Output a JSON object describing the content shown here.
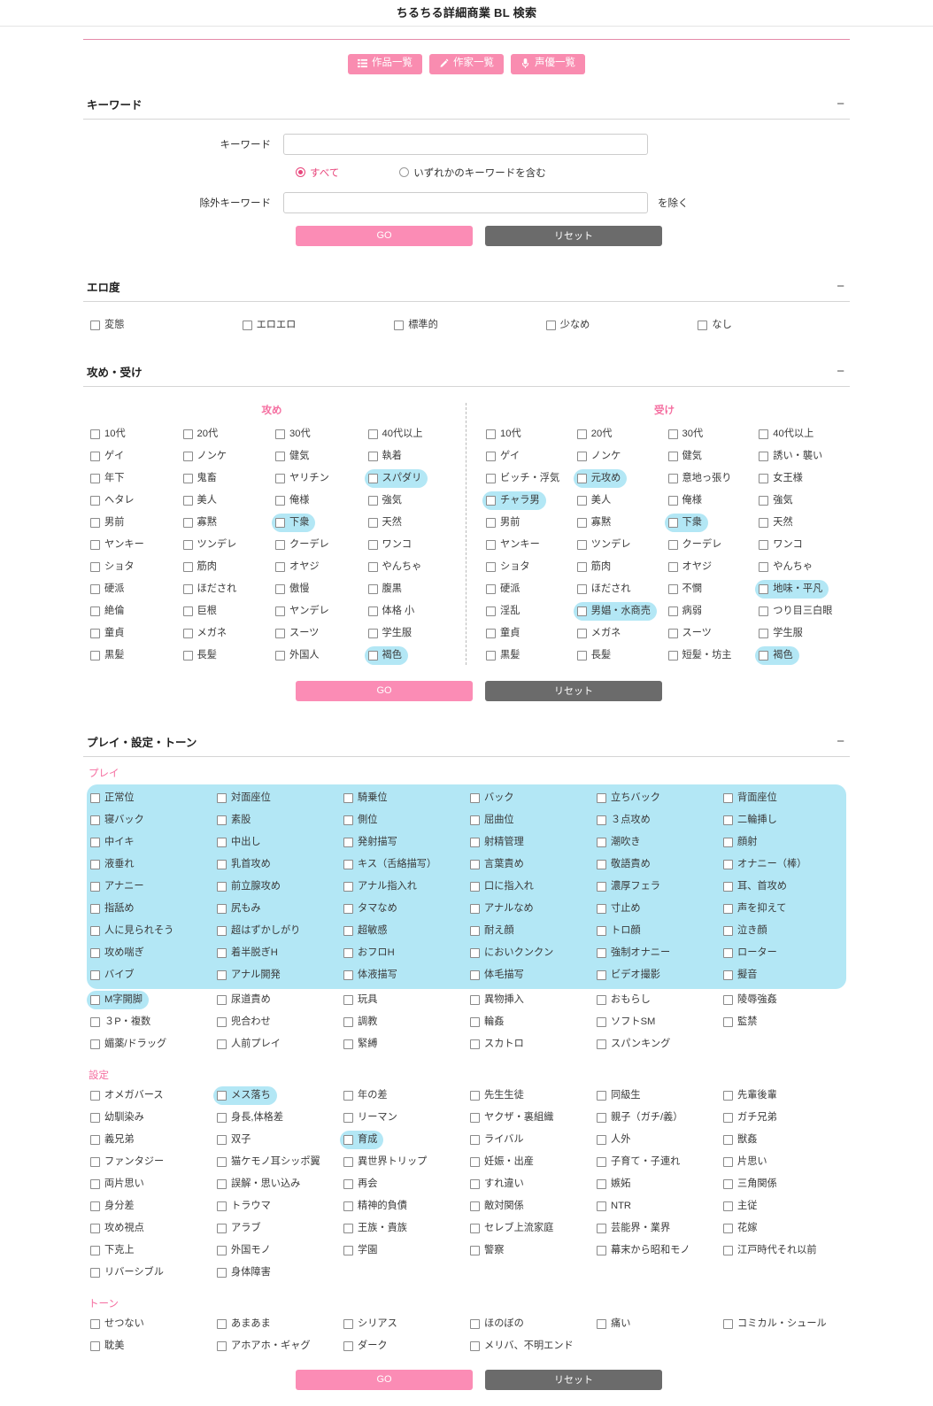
{
  "page": {
    "title": "ちるちる詳細商業 BL 検索"
  },
  "nav": [
    {
      "label": "作品一覧",
      "icon": "list-icon"
    },
    {
      "label": "作家一覧",
      "icon": "pencil-icon"
    },
    {
      "label": "声優一覧",
      "icon": "microphone-icon"
    }
  ],
  "buttons": {
    "go": "GO",
    "reset": "リセット",
    "collapse": "−"
  },
  "colors": {
    "accent_pink": "#f98cb0",
    "highlight_blue": "#b3e7f5",
    "reset_gray": "#6b6b6b",
    "label_pink": "#f56ea0"
  },
  "keyword": {
    "section_title": "キーワード",
    "keyword_label": "キーワード",
    "keyword_value": "",
    "keyword_placeholder": "",
    "exclude_label": "除外キーワード",
    "exclude_value": "",
    "exclude_placeholder": "",
    "exclude_suffix": "を除く",
    "radios": [
      {
        "label": "すべて",
        "selected": true
      },
      {
        "label": "いずれかのキーワードを含む",
        "selected": false
      }
    ]
  },
  "ero": {
    "section_title": "エロ度",
    "items": [
      {
        "label": "変態",
        "hl": false
      },
      {
        "label": "エロエロ",
        "hl": false
      },
      {
        "label": "標準的",
        "hl": false
      },
      {
        "label": "少なめ",
        "hl": false
      },
      {
        "label": "なし",
        "hl": false
      }
    ]
  },
  "semeuke": {
    "section_title": "攻め・受け",
    "seme_title": "攻め",
    "uke_title": "受け",
    "seme": [
      {
        "label": "10代",
        "hl": false
      },
      {
        "label": "20代",
        "hl": false
      },
      {
        "label": "30代",
        "hl": false
      },
      {
        "label": "40代以上",
        "hl": false
      },
      {
        "label": "ゲイ",
        "hl": false
      },
      {
        "label": "ノンケ",
        "hl": false
      },
      {
        "label": "健気",
        "hl": false
      },
      {
        "label": "執着",
        "hl": false
      },
      {
        "label": "年下",
        "hl": false
      },
      {
        "label": "鬼畜",
        "hl": false
      },
      {
        "label": "ヤリチン",
        "hl": false
      },
      {
        "label": "スパダリ",
        "hl": true
      },
      {
        "label": "ヘタレ",
        "hl": false
      },
      {
        "label": "美人",
        "hl": false
      },
      {
        "label": "俺様",
        "hl": false
      },
      {
        "label": "強気",
        "hl": false
      },
      {
        "label": "男前",
        "hl": false
      },
      {
        "label": "寡黙",
        "hl": false
      },
      {
        "label": "下衆",
        "hl": true
      },
      {
        "label": "天然",
        "hl": false
      },
      {
        "label": "ヤンキー",
        "hl": false
      },
      {
        "label": "ツンデレ",
        "hl": false
      },
      {
        "label": "クーデレ",
        "hl": false
      },
      {
        "label": "ワンコ",
        "hl": false
      },
      {
        "label": "ショタ",
        "hl": false
      },
      {
        "label": "筋肉",
        "hl": false
      },
      {
        "label": "オヤジ",
        "hl": false
      },
      {
        "label": "やんちゃ",
        "hl": false
      },
      {
        "label": "硬派",
        "hl": false
      },
      {
        "label": "ほだされ",
        "hl": false
      },
      {
        "label": "傲慢",
        "hl": false
      },
      {
        "label": "腹黒",
        "hl": false
      },
      {
        "label": "絶倫",
        "hl": false
      },
      {
        "label": "巨根",
        "hl": false
      },
      {
        "label": "ヤンデレ",
        "hl": false
      },
      {
        "label": "体格 小",
        "hl": false
      },
      {
        "label": "童貞",
        "hl": false
      },
      {
        "label": "メガネ",
        "hl": false
      },
      {
        "label": "スーツ",
        "hl": false
      },
      {
        "label": "学生服",
        "hl": false
      },
      {
        "label": "黒髪",
        "hl": false
      },
      {
        "label": "長髪",
        "hl": false
      },
      {
        "label": "外国人",
        "hl": false
      },
      {
        "label": "褐色",
        "hl": true
      }
    ],
    "uke": [
      {
        "label": "10代",
        "hl": false
      },
      {
        "label": "20代",
        "hl": false
      },
      {
        "label": "30代",
        "hl": false
      },
      {
        "label": "40代以上",
        "hl": false
      },
      {
        "label": "ゲイ",
        "hl": false
      },
      {
        "label": "ノンケ",
        "hl": false
      },
      {
        "label": "健気",
        "hl": false
      },
      {
        "label": "誘い・襲い",
        "hl": false
      },
      {
        "label": "ビッチ・浮気",
        "hl": false
      },
      {
        "label": "元攻め",
        "hl": true
      },
      {
        "label": "意地っ張り",
        "hl": false
      },
      {
        "label": "女王様",
        "hl": false
      },
      {
        "label": "チャラ男",
        "hl": true
      },
      {
        "label": "美人",
        "hl": false
      },
      {
        "label": "俺様",
        "hl": false
      },
      {
        "label": "強気",
        "hl": false
      },
      {
        "label": "男前",
        "hl": false
      },
      {
        "label": "寡黙",
        "hl": false
      },
      {
        "label": "下衆",
        "hl": true
      },
      {
        "label": "天然",
        "hl": false
      },
      {
        "label": "ヤンキー",
        "hl": false
      },
      {
        "label": "ツンデレ",
        "hl": false
      },
      {
        "label": "クーデレ",
        "hl": false
      },
      {
        "label": "ワンコ",
        "hl": false
      },
      {
        "label": "ショタ",
        "hl": false
      },
      {
        "label": "筋肉",
        "hl": false
      },
      {
        "label": "オヤジ",
        "hl": false
      },
      {
        "label": "やんちゃ",
        "hl": false
      },
      {
        "label": "硬派",
        "hl": false
      },
      {
        "label": "ほだされ",
        "hl": false
      },
      {
        "label": "不憫",
        "hl": false
      },
      {
        "label": "地味・平凡",
        "hl": true
      },
      {
        "label": "淫乱",
        "hl": false
      },
      {
        "label": "男娼・水商売",
        "hl": true
      },
      {
        "label": "病弱",
        "hl": false
      },
      {
        "label": "つり目三白眼",
        "hl": false
      },
      {
        "label": "童貞",
        "hl": false
      },
      {
        "label": "メガネ",
        "hl": false
      },
      {
        "label": "スーツ",
        "hl": false
      },
      {
        "label": "学生服",
        "hl": false
      },
      {
        "label": "黒髪",
        "hl": false
      },
      {
        "label": "長髪",
        "hl": false
      },
      {
        "label": "短髪・坊主",
        "hl": false
      },
      {
        "label": "褐色",
        "hl": true
      }
    ]
  },
  "pst": {
    "section_title": "プレイ・設定・トーン",
    "play_title": "プレイ",
    "setting_title": "設定",
    "tone_title": "トーン",
    "play_hl_rows": [
      [
        "正常位",
        "対面座位",
        "騎乗位",
        "バック",
        "立ちバック",
        "背面座位"
      ],
      [
        "寝バック",
        "素股",
        "側位",
        "屈曲位",
        "３点攻め",
        "二輪挿し"
      ],
      [
        "中イキ",
        "中出し",
        "発射描写",
        "射精管理",
        "潮吹き",
        "顔射"
      ],
      [
        "液垂れ",
        "乳首攻め",
        "キス（舌絡描写）",
        "言葉責め",
        "敬語責め",
        "オナニー（棒）"
      ],
      [
        "アナニー",
        "前立腺攻め",
        "アナル指入れ",
        "口に指入れ",
        "濃厚フェラ",
        "耳、首攻め"
      ],
      [
        "指舐め",
        "尻もみ",
        "タマなめ",
        "アナルなめ",
        "寸止め",
        "声を抑えて"
      ],
      [
        "人に見られそう",
        "超はずかしがり",
        "超敏感",
        "耐え顔",
        "トロ顔",
        "泣き顔"
      ],
      [
        "攻め喘ぎ",
        "着半脱ぎH",
        "おフロH",
        "においクンクン",
        "強制オナニー",
        "ローター"
      ],
      [
        "バイブ",
        "アナル開発",
        "体液描写",
        "体毛描写",
        "ビデオ撮影",
        "擬音"
      ]
    ],
    "play_rest": [
      {
        "label": "M字開脚",
        "hl": true
      },
      {
        "label": "尿道責め",
        "hl": false
      },
      {
        "label": "玩具",
        "hl": false
      },
      {
        "label": "異物挿入",
        "hl": false
      },
      {
        "label": "おもらし",
        "hl": false
      },
      {
        "label": "陵辱強姦",
        "hl": false
      },
      {
        "label": "３P・複数",
        "hl": false
      },
      {
        "label": "兜合わせ",
        "hl": false
      },
      {
        "label": "調教",
        "hl": false
      },
      {
        "label": "輪姦",
        "hl": false
      },
      {
        "label": "ソフトSM",
        "hl": false
      },
      {
        "label": "監禁",
        "hl": false
      },
      {
        "label": "媚薬/ドラッグ",
        "hl": false
      },
      {
        "label": "人前プレイ",
        "hl": false
      },
      {
        "label": "緊縛",
        "hl": false
      },
      {
        "label": "スカトロ",
        "hl": false
      },
      {
        "label": "スパンキング",
        "hl": false
      },
      {
        "label": "",
        "hl": false
      }
    ],
    "setting": [
      {
        "label": "オメガバース",
        "hl": false
      },
      {
        "label": "メス落ち",
        "hl": true
      },
      {
        "label": "年の差",
        "hl": false
      },
      {
        "label": "先生生徒",
        "hl": false
      },
      {
        "label": "同級生",
        "hl": false
      },
      {
        "label": "先輩後輩",
        "hl": false
      },
      {
        "label": "幼馴染み",
        "hl": false
      },
      {
        "label": "身長,体格差",
        "hl": false
      },
      {
        "label": "リーマン",
        "hl": false
      },
      {
        "label": "ヤクザ・裏組織",
        "hl": false
      },
      {
        "label": "親子（ガチ/義）",
        "hl": false
      },
      {
        "label": "ガチ兄弟",
        "hl": false
      },
      {
        "label": "義兄弟",
        "hl": false
      },
      {
        "label": "双子",
        "hl": false
      },
      {
        "label": "育成",
        "hl": true
      },
      {
        "label": "ライバル",
        "hl": false
      },
      {
        "label": "人外",
        "hl": false
      },
      {
        "label": "獣姦",
        "hl": false
      },
      {
        "label": "ファンタジー",
        "hl": false
      },
      {
        "label": "猫ケモノ耳シッポ翼",
        "hl": false
      },
      {
        "label": "異世界トリップ",
        "hl": false
      },
      {
        "label": "妊娠・出産",
        "hl": false
      },
      {
        "label": "子育て・子連れ",
        "hl": false
      },
      {
        "label": "片思い",
        "hl": false
      },
      {
        "label": "両片思い",
        "hl": false
      },
      {
        "label": "誤解・思い込み",
        "hl": false
      },
      {
        "label": "再会",
        "hl": false
      },
      {
        "label": "すれ違い",
        "hl": false
      },
      {
        "label": "嫉妬",
        "hl": false
      },
      {
        "label": "三角関係",
        "hl": false
      },
      {
        "label": "身分差",
        "hl": false
      },
      {
        "label": "トラウマ",
        "hl": false
      },
      {
        "label": "精神的負債",
        "hl": false
      },
      {
        "label": "敵対関係",
        "hl": false
      },
      {
        "label": "NTR",
        "hl": false
      },
      {
        "label": "主従",
        "hl": false
      },
      {
        "label": "攻め視点",
        "hl": false
      },
      {
        "label": "アラブ",
        "hl": false
      },
      {
        "label": "王族・貴族",
        "hl": false
      },
      {
        "label": "セレブ上流家庭",
        "hl": false
      },
      {
        "label": "芸能界・業界",
        "hl": false
      },
      {
        "label": "花嫁",
        "hl": false
      },
      {
        "label": "下克上",
        "hl": false
      },
      {
        "label": "外国モノ",
        "hl": false
      },
      {
        "label": "学園",
        "hl": false
      },
      {
        "label": "警察",
        "hl": false
      },
      {
        "label": "幕末から昭和モノ",
        "hl": false
      },
      {
        "label": "江戸時代それ以前",
        "hl": false
      },
      {
        "label": "リバーシブル",
        "hl": false
      },
      {
        "label": "身体障害",
        "hl": false
      },
      {
        "label": "",
        "hl": false
      },
      {
        "label": "",
        "hl": false
      },
      {
        "label": "",
        "hl": false
      },
      {
        "label": "",
        "hl": false
      }
    ],
    "tone": [
      {
        "label": "せつない",
        "hl": false
      },
      {
        "label": "あまあま",
        "hl": false
      },
      {
        "label": "シリアス",
        "hl": false
      },
      {
        "label": "ほのぼの",
        "hl": false
      },
      {
        "label": "痛い",
        "hl": false
      },
      {
        "label": "コミカル・シュール",
        "hl": false
      },
      {
        "label": "耽美",
        "hl": false
      },
      {
        "label": "アホアホ・ギャグ",
        "hl": false
      },
      {
        "label": "ダーク",
        "hl": false
      },
      {
        "label": "メリバ、不明エンド",
        "hl": false
      },
      {
        "label": "",
        "hl": false
      },
      {
        "label": "",
        "hl": false
      }
    ]
  }
}
